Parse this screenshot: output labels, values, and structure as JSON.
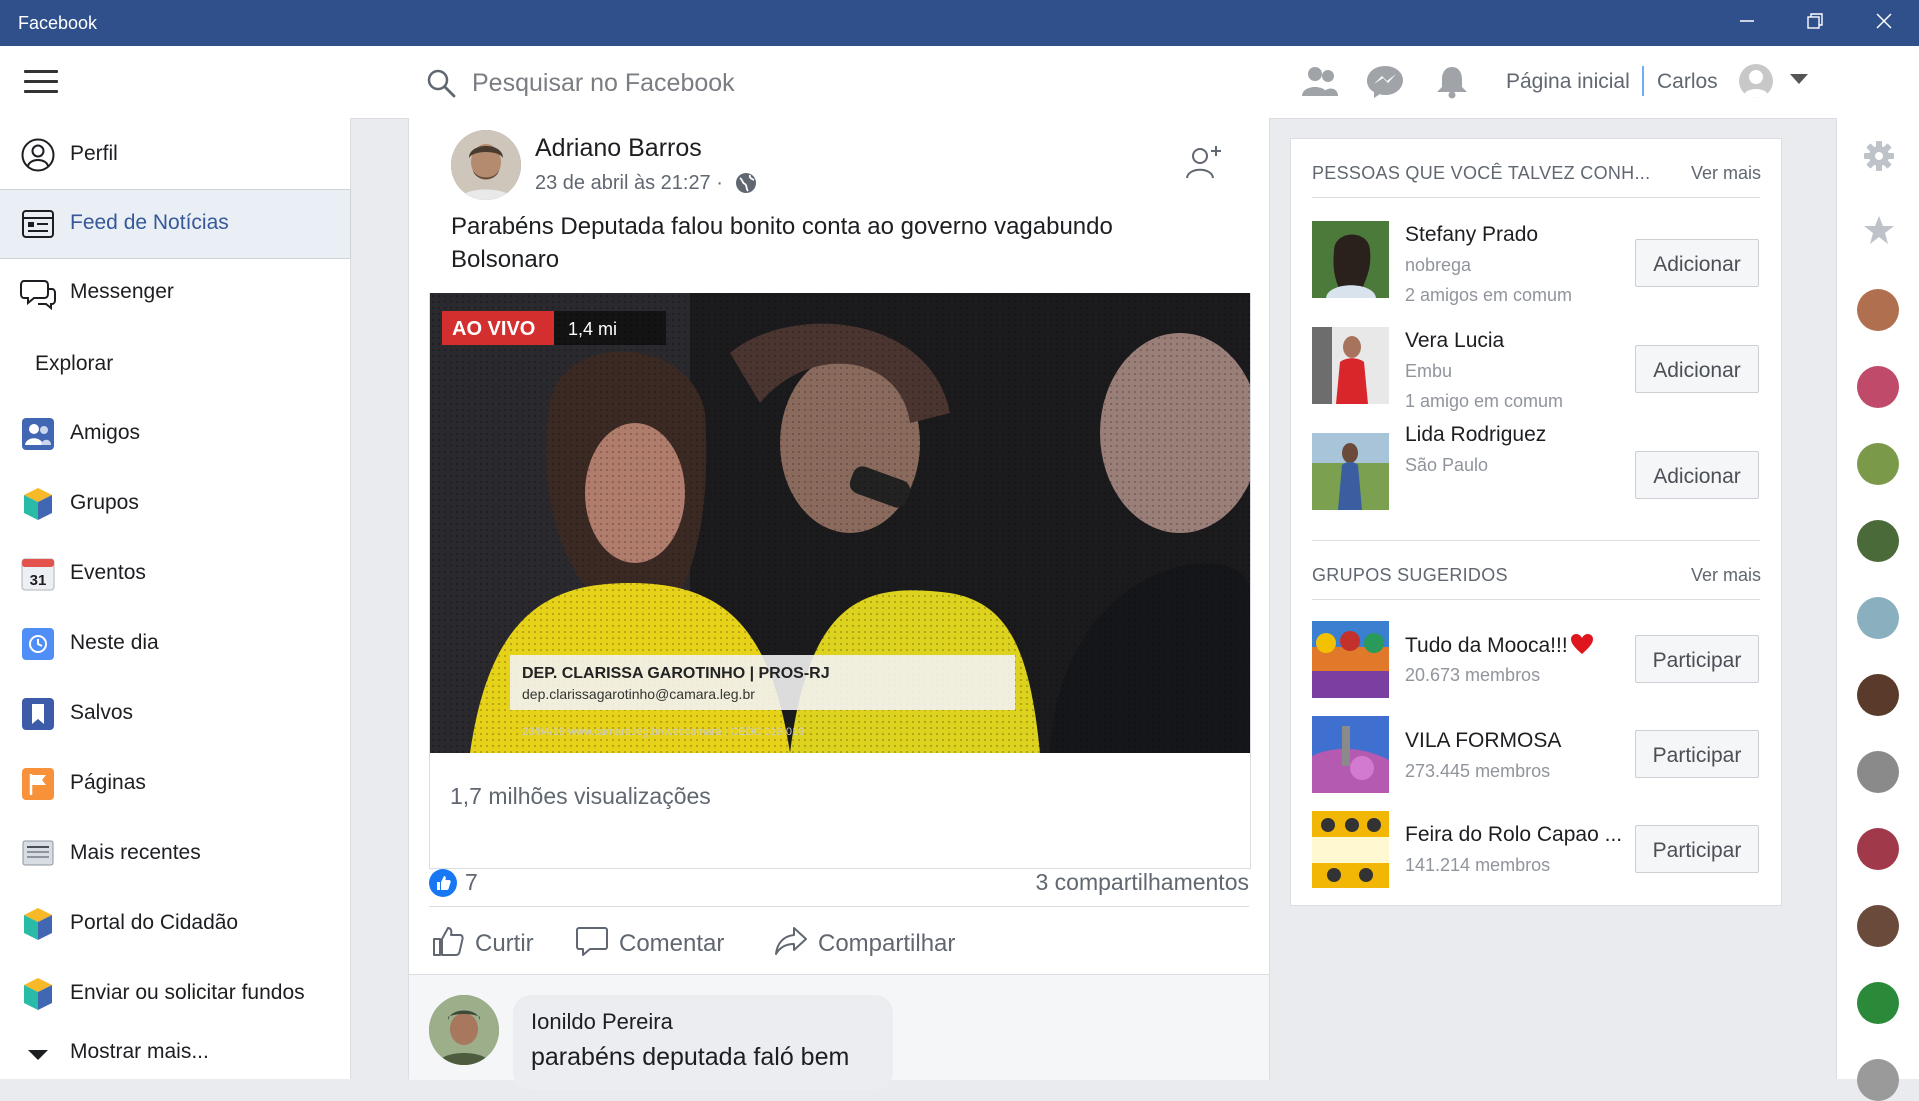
{
  "window": {
    "title": "Facebook"
  },
  "topbar": {
    "search_placeholder": "Pesquisar no Facebook",
    "home_label": "Página inicial",
    "user_name": "Carlos"
  },
  "sidebar": {
    "items": [
      {
        "label": "Perfil",
        "icon": "profile-icon"
      },
      {
        "label": "Feed de Notícias",
        "icon": "news-feed-icon",
        "active": true
      },
      {
        "label": "Messenger",
        "icon": "messenger-icon"
      }
    ],
    "explore_heading": "Explorar",
    "explore_items": [
      {
        "label": "Amigos",
        "icon": "friends-icon"
      },
      {
        "label": "Grupos",
        "icon": "groups-icon"
      },
      {
        "label": "Eventos",
        "icon": "calendar-icon",
        "icon_text": "31"
      },
      {
        "label": "Neste dia",
        "icon": "on-this-day-icon"
      },
      {
        "label": "Salvos",
        "icon": "bookmark-icon"
      },
      {
        "label": "Páginas",
        "icon": "flag-icon"
      },
      {
        "label": "Mais recentes",
        "icon": "recent-icon"
      },
      {
        "label": "Portal do Cidadão",
        "icon": "portal-icon"
      },
      {
        "label": "Enviar ou solicitar fundos",
        "icon": "funds-icon"
      }
    ],
    "show_more": "Mostrar mais..."
  },
  "post": {
    "author": "Adriano Barros",
    "time": "23 de abril às 21:27 ·",
    "text": "Parabéns Deputada falou bonito conta ao governo vagabundo Bolsonaro",
    "video": {
      "live_badge": "AO VIVO",
      "viewers": "1,4 mi",
      "caption_line1": "DEP. CLARISSA GAROTINHO | PROS-RJ",
      "caption_line2": "dep.clarissagarotinho@camara.leg.br",
      "caption_line3": "23/04/19      www.camara.leg.br/webcamara | CEDC 019 019"
    },
    "views": "1,7 milhões visualizações",
    "likes": "7",
    "shares": "3 compartilhamentos",
    "actions": {
      "like": "Curtir",
      "comment": "Comentar",
      "share": "Compartilhar"
    }
  },
  "comment": {
    "author": "Ionildo Pereira",
    "text": "parabéns deputada faló bem"
  },
  "people_suggestions": {
    "heading": "PESSOAS QUE VOCÊ TALVEZ CONH...",
    "see_more": "Ver mais",
    "items": [
      {
        "name": "Stefany Prado",
        "line1": "nobrega",
        "line2": "2 amigos em comum",
        "button": "Adicionar"
      },
      {
        "name": "Vera Lucia",
        "line1": "Embu",
        "line2": "1 amigo em comum",
        "button": "Adicionar"
      },
      {
        "name": "Lida Rodriguez",
        "line1": "São Paulo",
        "line2": "",
        "button": "Adicionar"
      }
    ]
  },
  "group_suggestions": {
    "heading": "GRUPOS SUGERIDOS",
    "see_more": "Ver mais",
    "items": [
      {
        "name": "Tudo da Mooca!!!",
        "members": "20.673 membros",
        "button": "Participar"
      },
      {
        "name": "VILA FORMOSA",
        "members": "273.445 membros",
        "button": "Participar"
      },
      {
        "name": "Feira do Rolo Capao ...",
        "members": "141.214 membros",
        "button": "Participar"
      }
    ]
  },
  "colors": {
    "titlebar": "#30508c",
    "accent": "#1877f2",
    "active_label": "#365899"
  }
}
